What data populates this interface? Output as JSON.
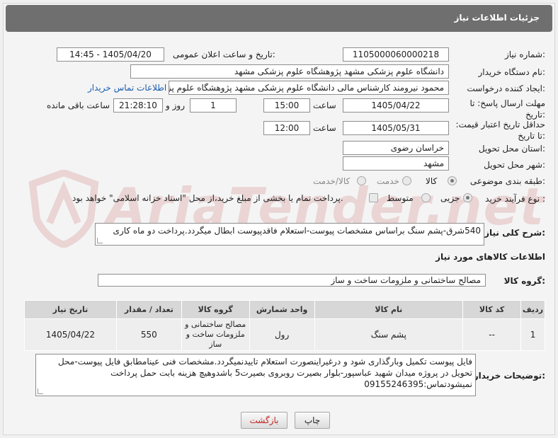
{
  "header": {
    "title": "جزئیات اطلاعات نیاز"
  },
  "watermark": {
    "text": "AriaTender.net"
  },
  "fields": {
    "need_number": {
      "label": "شماره نیاز:",
      "value": "1105000060000218"
    },
    "announce_datetime": {
      "label": "تاریخ و ساعت اعلان عمومی:",
      "value": "1405/04/20 - 14:45"
    },
    "buyer_org": {
      "label": "نام دستگاه خریدار:",
      "value": "دانشگاه علوم پزشکی مشهد   پژوهشگاه علوم پزشکی مشهد"
    },
    "requester": {
      "label": "ایجاد کننده درخواست:",
      "value": "محمود نیرومند کارشناس مالی دانشگاه علوم پزشکی مشهد   پژوهشگاه علوم پزشکی مشهد",
      "contact_link": "اطلاعات تماس خریدار"
    },
    "reply_deadline": {
      "label": "مهلت ارسال پاسخ: تا تاریخ:",
      "date": "1405/04/22",
      "time_label": "ساعت",
      "time": "15:00",
      "days": "1",
      "days_label": "روز و",
      "remaining": "21:28:10",
      "remaining_label": "ساعت باقی مانده"
    },
    "price_validity": {
      "label": "حداقل تاریخ اعتبار قیمت: تا تاریخ:",
      "date": "1405/05/31",
      "time_label": "ساعت",
      "time": "12:00"
    },
    "delivery_province": {
      "label": "استان محل تحویل:",
      "value": "خراسان رضوی"
    },
    "delivery_city": {
      "label": "شهر محل تحویل:",
      "value": "مشهد"
    },
    "category": {
      "label": "طبقه بندی موضوعی:",
      "options": [
        "کالا",
        "خدمت",
        "کالا/خدمت"
      ],
      "selected": "کالا"
    },
    "purchase_process": {
      "label": "نوع فرآیند خرید :",
      "options": [
        "جزیی",
        "متوسط"
      ],
      "selected": "جزیی",
      "payment_note": "پرداخت تمام یا بخشی از مبلغ خرید،از محل \"اسناد خزانه اسلامی\" خواهد بود."
    }
  },
  "general_description": {
    "label": "شرح کلی نیاز:",
    "value": "540شرق-پشم سنگ براساس مشخصات پیوست-استعلام فاقدپیوست ابطال میگردد.پرداخت دو ماه کاری"
  },
  "goods_info": {
    "section_title": "اطلاعات کالاهای مورد نیاز",
    "group_label": "گروه کالا:",
    "group_value": "مصالح ساختمانی و ملزومات ساخت و ساز",
    "table": {
      "headers": [
        "ردیف",
        "کد کالا",
        "نام کالا",
        "واحد شمارش",
        "گروه کالا",
        "تعداد / مقدار",
        "تاریخ نیاز"
      ],
      "rows": [
        [
          "1",
          "--",
          "پشم سنگ",
          "رول",
          "مصالح ساختمانی و ملزومات ساخت و ساز",
          "550",
          "1405/04/22"
        ]
      ]
    }
  },
  "buyer_notes": {
    "label": "توضیحات خریدار:",
    "value": "فایل پیوست تکمیل وبارگذاری شود و درغیراینصورت استعلام تاییدنمیگردد.مشخصات فنی عینامطابق فایل پیوست-محل تحویل در پروژه میدان شهید عباسپور-بلوار بصیرت روبروی بصیرت5 باشدوهیچ هزینه بابت حمل  پرداخت نمیشودتماس:09155246395"
  },
  "buttons": {
    "print": "چاپ",
    "back": "بازگشت"
  }
}
